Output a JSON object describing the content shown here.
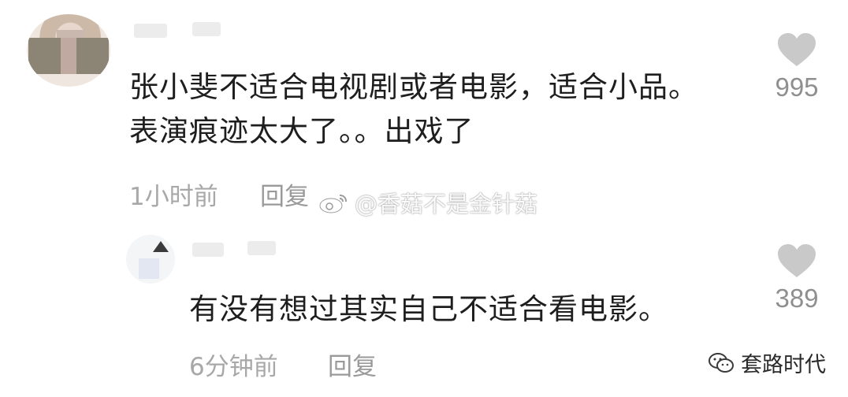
{
  "comment": {
    "lines": [
      "张小斐不适合电视剧或者电影，适合小品。",
      "表演痕迹太大了。。出戏了"
    ],
    "time": "1小时前",
    "reply_label": "回复",
    "likes": "995"
  },
  "reply": {
    "text": "有没有想过其实自己不适合看电影。",
    "time": "6分钟前",
    "reply_label": "回复",
    "likes": "389"
  },
  "watermark": {
    "text": "@香菇不是金针菇",
    "icon": "weibo-icon"
  },
  "brand": {
    "text": "套路时代",
    "icon": "wechat-icon"
  },
  "colors": {
    "text": "#1e1e1e",
    "meta": "#a8a8a8",
    "heart": "#c9c9c9"
  }
}
